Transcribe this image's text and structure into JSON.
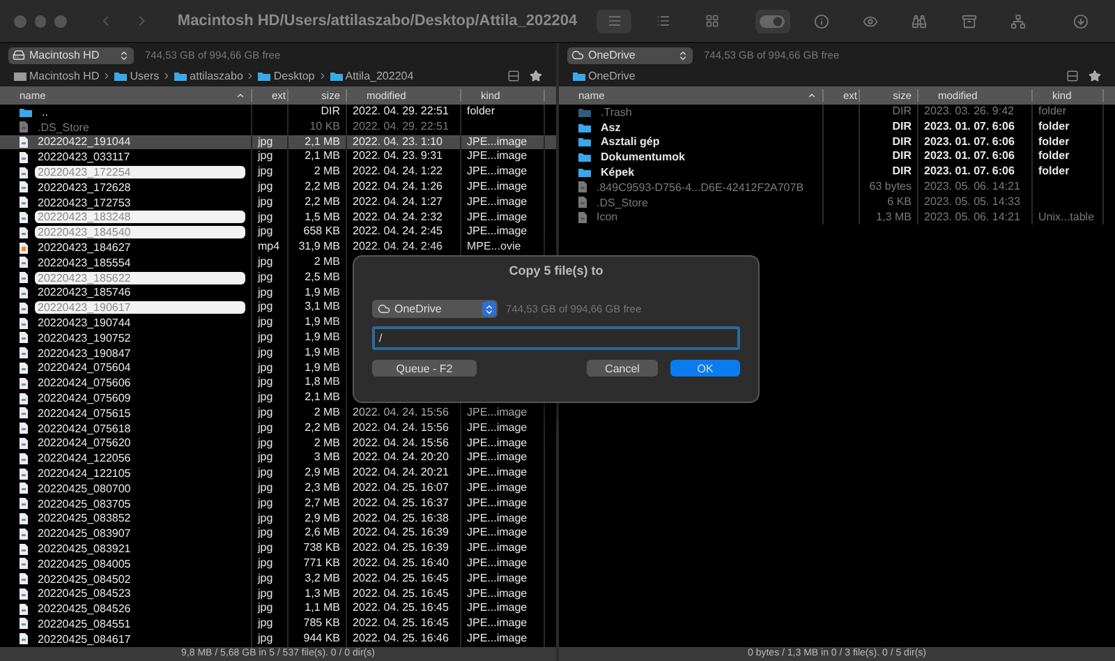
{
  "window": {
    "title": "Macintosh HD/Users/attilaszabo/Desktop/Attila_202204"
  },
  "toolbar": {
    "view_modes": [
      {
        "kind": "list",
        "selected": true
      },
      {
        "kind": "details",
        "selected": false
      },
      {
        "kind": "grid",
        "selected": false
      }
    ],
    "toggle": {
      "on": true
    }
  },
  "left": {
    "drive": {
      "label": "Macintosh HD",
      "kind": "disk"
    },
    "free": "744,53 GB of 994,66 GB free",
    "breadcrumb": [
      {
        "label": "Macintosh HD",
        "kind": "disk"
      },
      {
        "label": "Users",
        "kind": "folder"
      },
      {
        "label": "attilaszabo",
        "kind": "folder"
      },
      {
        "label": "Desktop",
        "kind": "folder"
      },
      {
        "label": "Attila_202204",
        "kind": "folder"
      }
    ],
    "columns": [
      "name",
      "ext",
      "size",
      "modified",
      "kind"
    ],
    "rows": [
      {
        "name": "..",
        "kind": "folder",
        "size": "DIR",
        "modified": "2022. 04. 29. 22:51",
        "type": "folder",
        "hidden": false,
        "selected": false,
        "cursor": false
      },
      {
        "name": ".DS_Store",
        "kind": "file",
        "size": "10 KB",
        "modified": "2022. 04. 29. 22:51",
        "hidden": true,
        "selected": false,
        "cursor": false
      },
      {
        "name": "20220422_191044",
        "kind": "file",
        "ext": "jpg",
        "size": "2,1 MB",
        "modified": "2022. 04. 23. 1:10",
        "type": "JPE...image",
        "hidden": false,
        "selected": false,
        "cursor": true
      },
      {
        "name": "20220423_033117",
        "kind": "file",
        "ext": "jpg",
        "size": "2,1 MB",
        "modified": "2022. 04. 23. 9:31",
        "type": "JPE...image",
        "hidden": false,
        "selected": false,
        "cursor": false
      },
      {
        "name": "20220423_172254",
        "kind": "file",
        "ext": "jpg",
        "size": "2 MB",
        "modified": "2022. 04. 24. 1:22",
        "type": "JPE...image",
        "hidden": false,
        "selected": true,
        "cursor": false
      },
      {
        "name": "20220423_172628",
        "kind": "file",
        "ext": "jpg",
        "size": "2,2 MB",
        "modified": "2022. 04. 24. 1:26",
        "type": "JPE...image",
        "hidden": false,
        "selected": false,
        "cursor": false
      },
      {
        "name": "20220423_172753",
        "kind": "file",
        "ext": "jpg",
        "size": "2,2 MB",
        "modified": "2022. 04. 24. 1:27",
        "type": "JPE...image",
        "hidden": false,
        "selected": false,
        "cursor": false
      },
      {
        "name": "20220423_183248",
        "kind": "file",
        "ext": "jpg",
        "size": "1,5 MB",
        "modified": "2022. 04. 24. 2:32",
        "type": "JPE...image",
        "hidden": false,
        "selected": true,
        "cursor": false
      },
      {
        "name": "20220423_184540",
        "kind": "file",
        "ext": "jpg",
        "size": "658 KB",
        "modified": "2022. 04. 24. 2:45",
        "type": "JPE...image",
        "hidden": false,
        "selected": true,
        "cursor": false
      },
      {
        "name": "20220423_184627",
        "kind": "video",
        "ext": "mp4",
        "size": "31,9 MB",
        "modified": "2022. 04. 24. 2:46",
        "type": "MPE...ovie",
        "hidden": false,
        "selected": false,
        "cursor": false
      },
      {
        "name": "20220423_185554",
        "kind": "file",
        "ext": "jpg",
        "size": "2 MB",
        "hidden": false,
        "selected": false,
        "cursor": false
      },
      {
        "name": "20220423_185622",
        "kind": "file",
        "ext": "jpg",
        "size": "2,5 MB",
        "hidden": false,
        "selected": true,
        "cursor": false
      },
      {
        "name": "20220423_185746",
        "kind": "file",
        "ext": "jpg",
        "size": "1,9 MB",
        "hidden": false,
        "selected": false,
        "cursor": false
      },
      {
        "name": "20220423_190617",
        "kind": "file",
        "ext": "jpg",
        "size": "3,1 MB",
        "hidden": false,
        "selected": true,
        "cursor": false
      },
      {
        "name": "20220423_190744",
        "kind": "file",
        "ext": "jpg",
        "size": "1,9 MB",
        "hidden": false,
        "selected": false,
        "cursor": false
      },
      {
        "name": "20220423_190752",
        "kind": "file",
        "ext": "jpg",
        "size": "1,9 MB",
        "hidden": false,
        "selected": false,
        "cursor": false
      },
      {
        "name": "20220423_190847",
        "kind": "file",
        "ext": "jpg",
        "size": "1,9 MB",
        "hidden": false,
        "selected": false,
        "cursor": false
      },
      {
        "name": "20220424_075604",
        "kind": "file",
        "ext": "jpg",
        "size": "1,9 MB",
        "hidden": false,
        "selected": false,
        "cursor": false
      },
      {
        "name": "20220424_075606",
        "kind": "file",
        "ext": "jpg",
        "size": "1,8 MB",
        "hidden": false,
        "selected": false,
        "cursor": false
      },
      {
        "name": "20220424_075609",
        "kind": "file",
        "ext": "jpg",
        "size": "2,1 MB",
        "hidden": false,
        "selected": false,
        "cursor": false
      },
      {
        "name": "20220424_075615",
        "kind": "file",
        "ext": "jpg",
        "size": "2 MB",
        "modified": "2022. 04. 24. 15:56",
        "type": "JPE...image",
        "hidden": false,
        "selected": false,
        "cursor": false
      },
      {
        "name": "20220424_075618",
        "kind": "file",
        "ext": "jpg",
        "size": "2,2 MB",
        "modified": "2022. 04. 24. 15:56",
        "type": "JPE...image",
        "hidden": false,
        "selected": false,
        "cursor": false
      },
      {
        "name": "20220424_075620",
        "kind": "file",
        "ext": "jpg",
        "size": "2 MB",
        "modified": "2022. 04. 24. 15:56",
        "type": "JPE...image",
        "hidden": false,
        "selected": false,
        "cursor": false
      },
      {
        "name": "20220424_122056",
        "kind": "file",
        "ext": "jpg",
        "size": "3 MB",
        "modified": "2022. 04. 24. 20:20",
        "type": "JPE...image",
        "hidden": false,
        "selected": false,
        "cursor": false
      },
      {
        "name": "20220424_122105",
        "kind": "file",
        "ext": "jpg",
        "size": "2,9 MB",
        "modified": "2022. 04. 24. 20:21",
        "type": "JPE...image",
        "hidden": false,
        "selected": false,
        "cursor": false
      },
      {
        "name": "20220425_080700",
        "kind": "file",
        "ext": "jpg",
        "size": "2,3 MB",
        "modified": "2022. 04. 25. 16:07",
        "type": "JPE...image",
        "hidden": false,
        "selected": false,
        "cursor": false
      },
      {
        "name": "20220425_083705",
        "kind": "file",
        "ext": "jpg",
        "size": "2,7 MB",
        "modified": "2022. 04. 25. 16:37",
        "type": "JPE...image",
        "hidden": false,
        "selected": false,
        "cursor": false
      },
      {
        "name": "20220425_083852",
        "kind": "file",
        "ext": "jpg",
        "size": "2,9 MB",
        "modified": "2022. 04. 25. 16:38",
        "type": "JPE...image",
        "hidden": false,
        "selected": false,
        "cursor": false
      },
      {
        "name": "20220425_083907",
        "kind": "file",
        "ext": "jpg",
        "size": "2,6 MB",
        "modified": "2022. 04. 25. 16:39",
        "type": "JPE...image",
        "hidden": false,
        "selected": false,
        "cursor": false
      },
      {
        "name": "20220425_083921",
        "kind": "file",
        "ext": "jpg",
        "size": "738 KB",
        "modified": "2022. 04. 25. 16:39",
        "type": "JPE...image",
        "hidden": false,
        "selected": false,
        "cursor": false
      },
      {
        "name": "20220425_084005",
        "kind": "file",
        "ext": "jpg",
        "size": "771 KB",
        "modified": "2022. 04. 25. 16:40",
        "type": "JPE...image",
        "hidden": false,
        "selected": false,
        "cursor": false
      },
      {
        "name": "20220425_084502",
        "kind": "file",
        "ext": "jpg",
        "size": "3,2 MB",
        "modified": "2022. 04. 25. 16:45",
        "type": "JPE...image",
        "hidden": false,
        "selected": false,
        "cursor": false
      },
      {
        "name": "20220425_084523",
        "kind": "file",
        "ext": "jpg",
        "size": "1,3 MB",
        "modified": "2022. 04. 25. 16:45",
        "type": "JPE...image",
        "hidden": false,
        "selected": false,
        "cursor": false
      },
      {
        "name": "20220425_084526",
        "kind": "file",
        "ext": "jpg",
        "size": "1,1 MB",
        "modified": "2022. 04. 25. 16:45",
        "type": "JPE...image",
        "hidden": false,
        "selected": false,
        "cursor": false
      },
      {
        "name": "20220425_084551",
        "kind": "file",
        "ext": "jpg",
        "size": "785 KB",
        "modified": "2022. 04. 25. 16:45",
        "type": "JPE...image",
        "hidden": false,
        "selected": false,
        "cursor": false
      },
      {
        "name": "20220425_084617",
        "kind": "file",
        "ext": "jpg",
        "size": "944 KB",
        "modified": "2022. 04. 25. 16:46",
        "type": "JPE...image",
        "hidden": false,
        "selected": false,
        "cursor": false
      }
    ],
    "status": "9,8 MB / 5,68 GB in 5 / 537 file(s). 0 / 0 dir(s)"
  },
  "right": {
    "drive": {
      "label": "OneDrive",
      "kind": "cloud"
    },
    "free": "744,53 GB of 994,66 GB free",
    "breadcrumb": [
      {
        "label": "OneDrive",
        "kind": "folder"
      }
    ],
    "columns": [
      "name",
      "ext",
      "size",
      "modified",
      "kind"
    ],
    "rows": [
      {
        "name": ".Trash",
        "kind": "folder",
        "size": "DIR",
        "modified": "2023. 03. 26. 9:42",
        "type": "folder",
        "hidden": true,
        "selected": false,
        "cursor": false
      },
      {
        "name": "Asz",
        "kind": "folder",
        "size": "DIR",
        "modified": "2023. 01. 07. 6:06",
        "type": "folder",
        "hidden": false,
        "selected": false,
        "cursor": false
      },
      {
        "name": "Asztali gép",
        "kind": "folder",
        "size": "DIR",
        "modified": "2023. 01. 07. 6:06",
        "type": "folder",
        "hidden": false,
        "selected": false,
        "cursor": false
      },
      {
        "name": "Dokumentumok",
        "kind": "folder",
        "size": "DIR",
        "modified": "2023. 01. 07. 6:06",
        "type": "folder",
        "hidden": false,
        "selected": false,
        "cursor": false
      },
      {
        "name": "Képek",
        "kind": "folder",
        "size": "DIR",
        "modified": "2023. 01. 07. 6:06",
        "type": "folder",
        "hidden": false,
        "selected": false,
        "cursor": false
      },
      {
        "name": ".849C9593-D756-4...D6E-42412F2A707B",
        "kind": "file",
        "size": "63 bytes",
        "modified": "2023. 05. 06. 14:21",
        "hidden": true,
        "selected": false,
        "cursor": false
      },
      {
        "name": ".DS_Store",
        "kind": "file",
        "size": "6 KB",
        "modified": "2023. 05. 05. 14:33",
        "hidden": true,
        "selected": false,
        "cursor": false
      },
      {
        "name": "Icon",
        "kind": "file",
        "size": "1,3 MB",
        "modified": "2023. 05. 06. 14:21",
        "type": "Unix...table",
        "hidden": true,
        "selected": false,
        "cursor": false
      }
    ],
    "status": "0 bytes / 1,3 MB in 0 / 3 file(s). 0 / 5 dir(s)"
  },
  "dialog": {
    "title": "Copy 5 file(s) to",
    "drive": {
      "label": "OneDrive",
      "kind": "cloud"
    },
    "free": "744,53 GB of 994,66 GB free",
    "path": "/",
    "buttons": [
      {
        "label": "Queue - F2",
        "kind": "secondary"
      },
      {
        "label": "Cancel",
        "kind": "secondary"
      },
      {
        "label": "OK",
        "kind": "primary"
      }
    ]
  }
}
